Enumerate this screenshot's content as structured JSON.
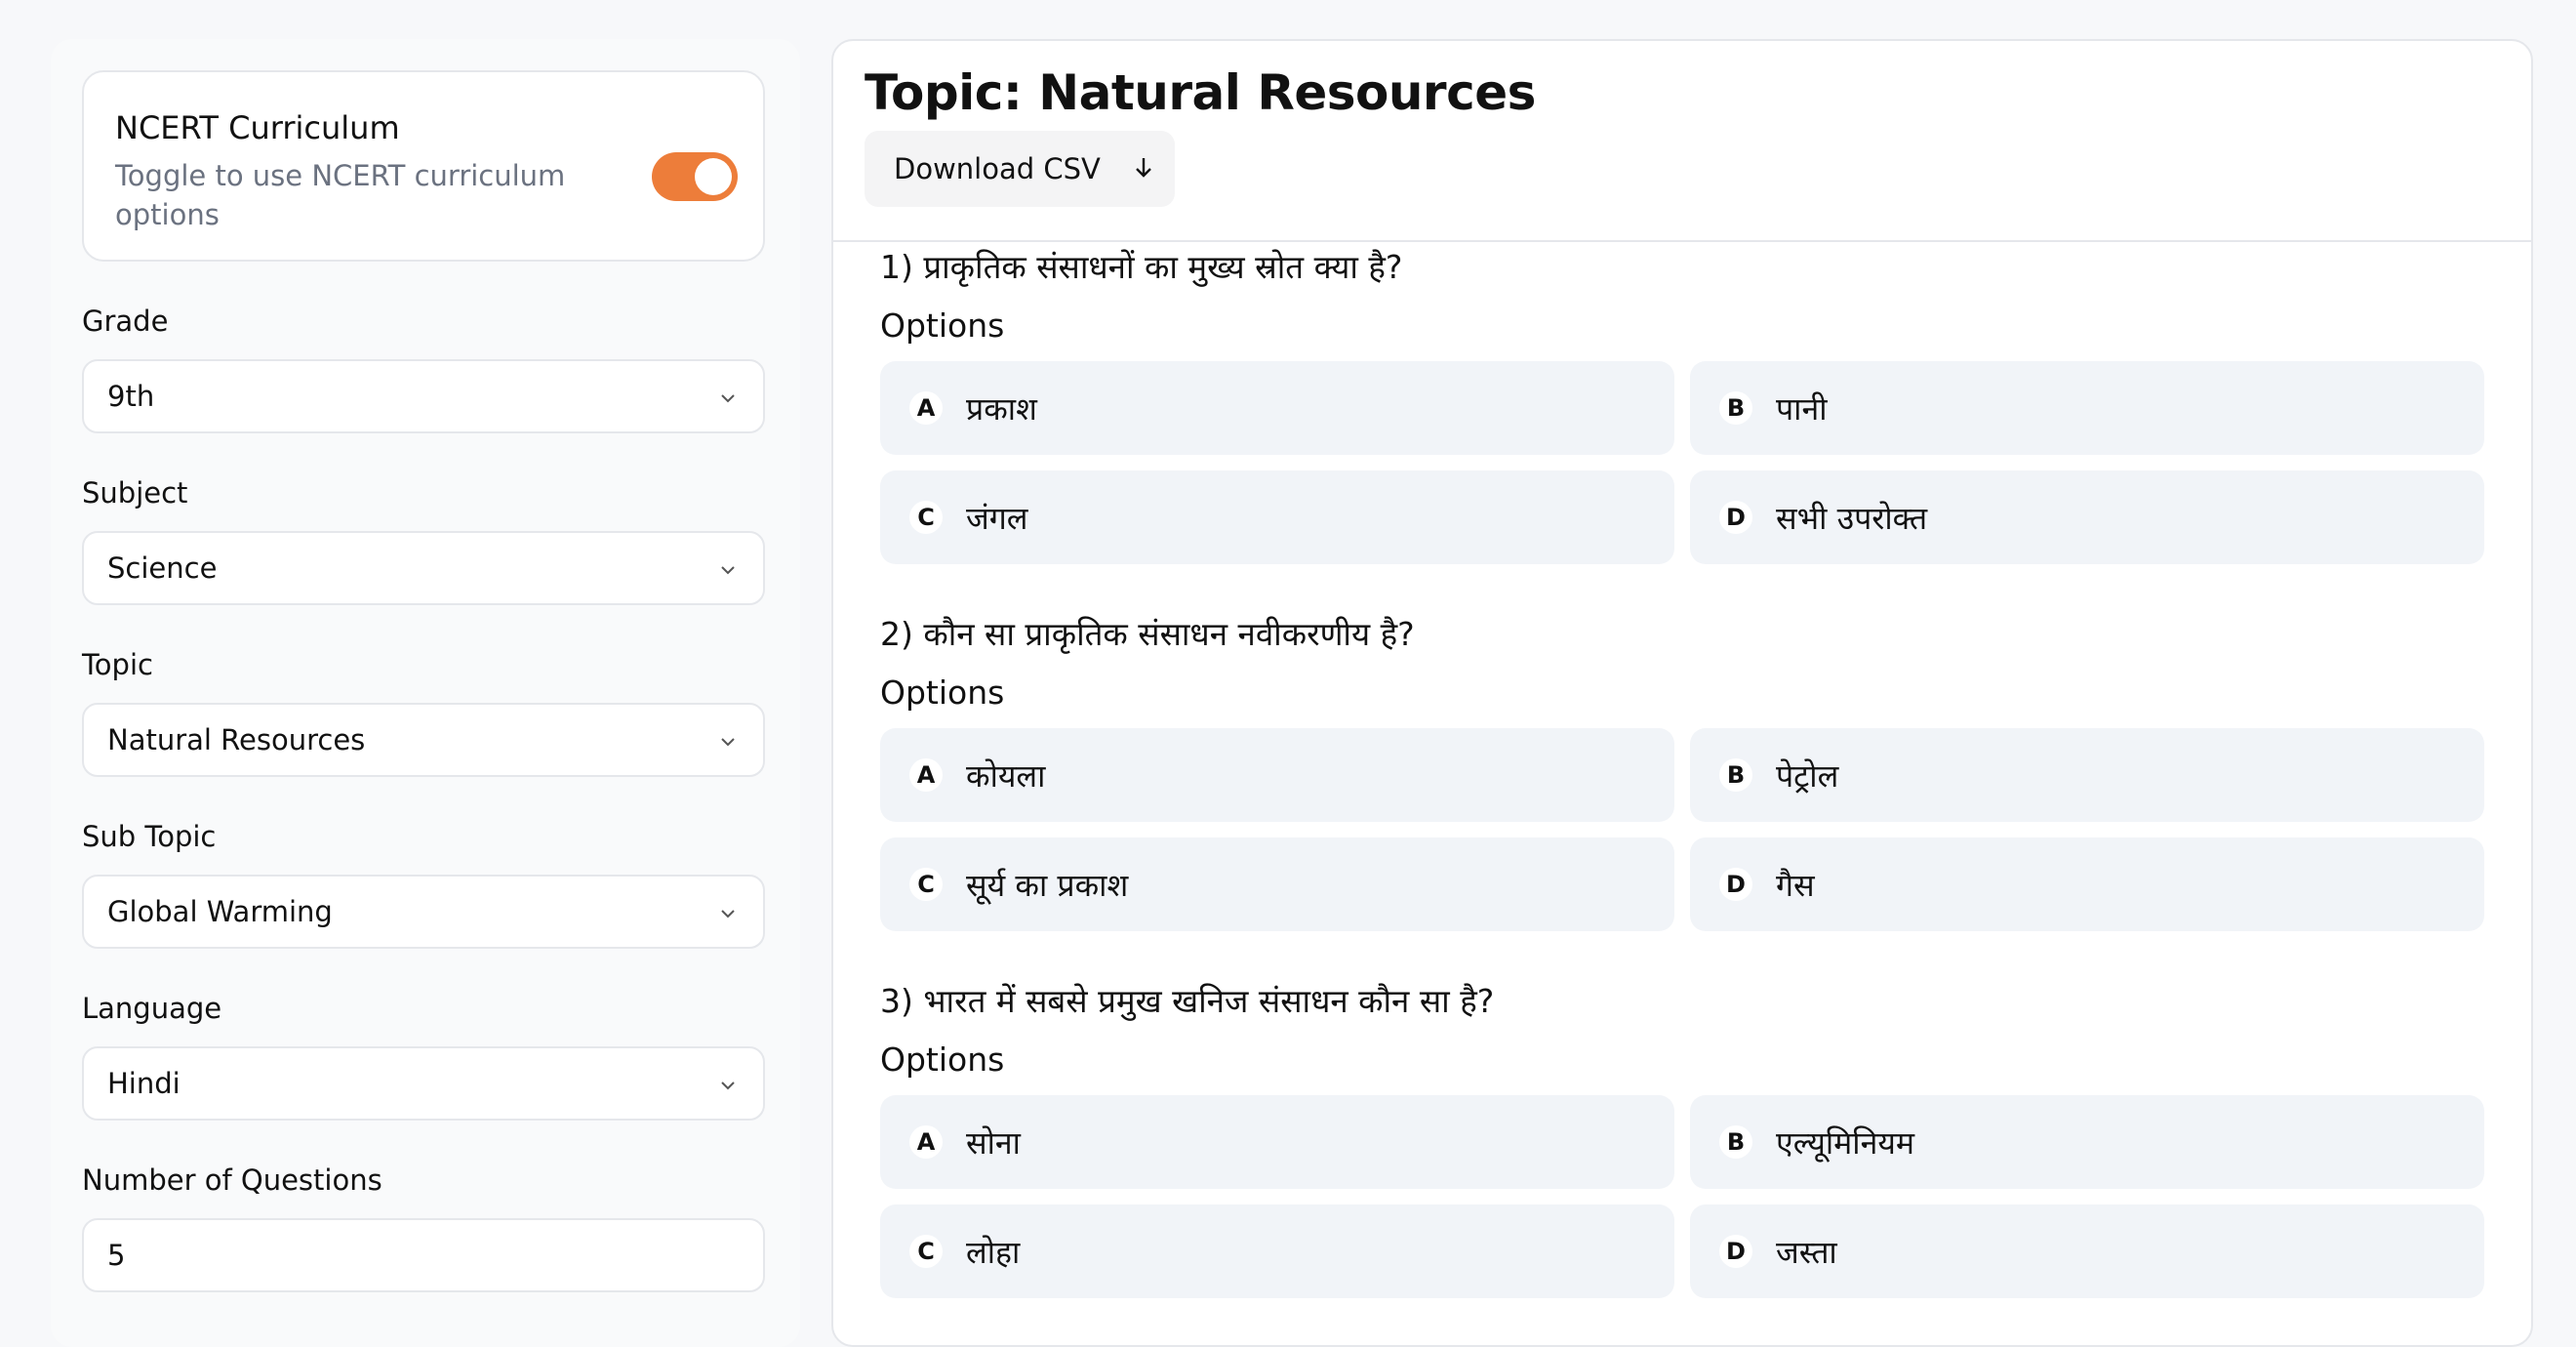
{
  "sidebar": {
    "ncert": {
      "title": "NCERT Curriculum",
      "description": "Toggle to use NCERT curriculum options",
      "enabled": true
    },
    "grade": {
      "label": "Grade",
      "value": "9th"
    },
    "subject": {
      "label": "Subject",
      "value": "Science"
    },
    "topic": {
      "label": "Topic",
      "value": "Natural Resources"
    },
    "sub_topic": {
      "label": "Sub Topic",
      "value": "Global Warming"
    },
    "language": {
      "label": "Language",
      "value": "Hindi"
    },
    "num_questions": {
      "label": "Number of Questions",
      "value": "5"
    }
  },
  "main": {
    "title": "Topic: Natural Resources",
    "download_label": "Download CSV",
    "options_label": "Options",
    "questions": [
      {
        "text": "1) प्राकृतिक संसाधनों का मुख्य स्रोत क्या है?",
        "options": [
          {
            "letter": "A",
            "text": "प्रकाश"
          },
          {
            "letter": "B",
            "text": "पानी"
          },
          {
            "letter": "C",
            "text": "जंगल"
          },
          {
            "letter": "D",
            "text": "सभी उपरोक्त"
          }
        ]
      },
      {
        "text": "2) कौन सा प्राकृतिक संसाधन नवीकरणीय है?",
        "options": [
          {
            "letter": "A",
            "text": "कोयला"
          },
          {
            "letter": "B",
            "text": "पेट्रोल"
          },
          {
            "letter": "C",
            "text": "सूर्य का प्रकाश"
          },
          {
            "letter": "D",
            "text": "गैस"
          }
        ]
      },
      {
        "text": "3) भारत में सबसे प्रमुख खनिज संसाधन कौन सा है?",
        "options": [
          {
            "letter": "A",
            "text": "सोना"
          },
          {
            "letter": "B",
            "text": "एल्यूमिनियम"
          },
          {
            "letter": "C",
            "text": "लोहा"
          },
          {
            "letter": "D",
            "text": "जस्ता"
          }
        ]
      }
    ]
  },
  "colors": {
    "accent": "#ed7d3a",
    "option_bg": "#f1f4f8",
    "border": "#e5e7eb"
  },
  "icons": {
    "select": "chevron-down-icon",
    "download": "arrow-down-icon"
  }
}
